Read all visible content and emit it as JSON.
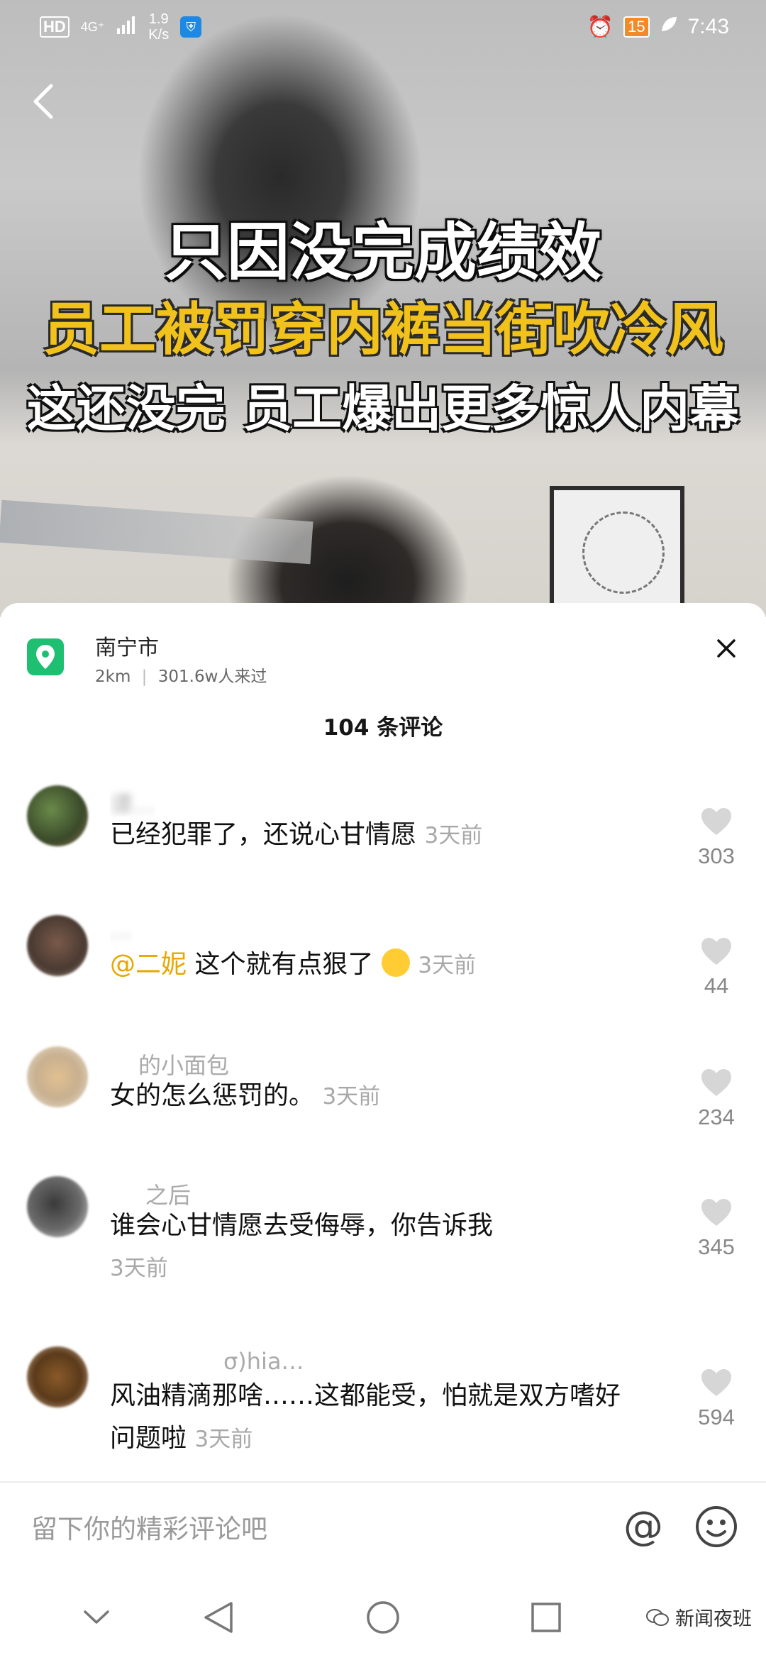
{
  "status_bar": {
    "network_hd": "HD",
    "network_type": "4G⁺",
    "speed_value": "1.9",
    "speed_unit": "K/s",
    "battery": "15",
    "time": "7:43"
  },
  "video": {
    "caption_line1": "只因没完成绩效",
    "caption_line2": "员工被罚穿内裤当街吹冷风",
    "caption_line3": "这还没完 员工爆出更多惊人内幕"
  },
  "location": {
    "name": "南宁市",
    "distance": "2km",
    "separator": "|",
    "visitors": "301.6w人来过"
  },
  "comment_count": "104 条评论",
  "comments": [
    {
      "user": "谭…",
      "text": "已经犯罪了，还说心甘情愿",
      "time": "3天前",
      "likes": "303"
    },
    {
      "user": "…",
      "mention": "@二妮",
      "text": " 这个就有点狠了",
      "time": "3天前",
      "likes": "44"
    },
    {
      "user": "的小面包",
      "text": "女的怎么惩罚的。",
      "time": "3天前",
      "likes": "234"
    },
    {
      "user": "之后",
      "text": "谁会心甘情愿去受侮辱，你告诉我",
      "time": "3天前",
      "likes": "345"
    },
    {
      "user": "σ)hia…",
      "text": "风油精滴那啥……这都能受，怕就是双方嗜好问题啦",
      "time": "3天前",
      "likes": "594"
    }
  ],
  "input": {
    "placeholder": "留下你的精彩评论吧",
    "at_symbol": "@"
  },
  "watermark": "新闻夜班",
  "colors": {
    "location_green": "#1fbf72",
    "mention_yellow": "#e8a600",
    "caption_yellow": "#f2c21c"
  },
  "icons": [
    "back-icon",
    "location-pin-icon",
    "close-icon",
    "heart-icon",
    "at-icon",
    "emoji-icon",
    "nav-down-icon",
    "nav-back-icon",
    "nav-home-icon",
    "nav-recents-icon"
  ]
}
